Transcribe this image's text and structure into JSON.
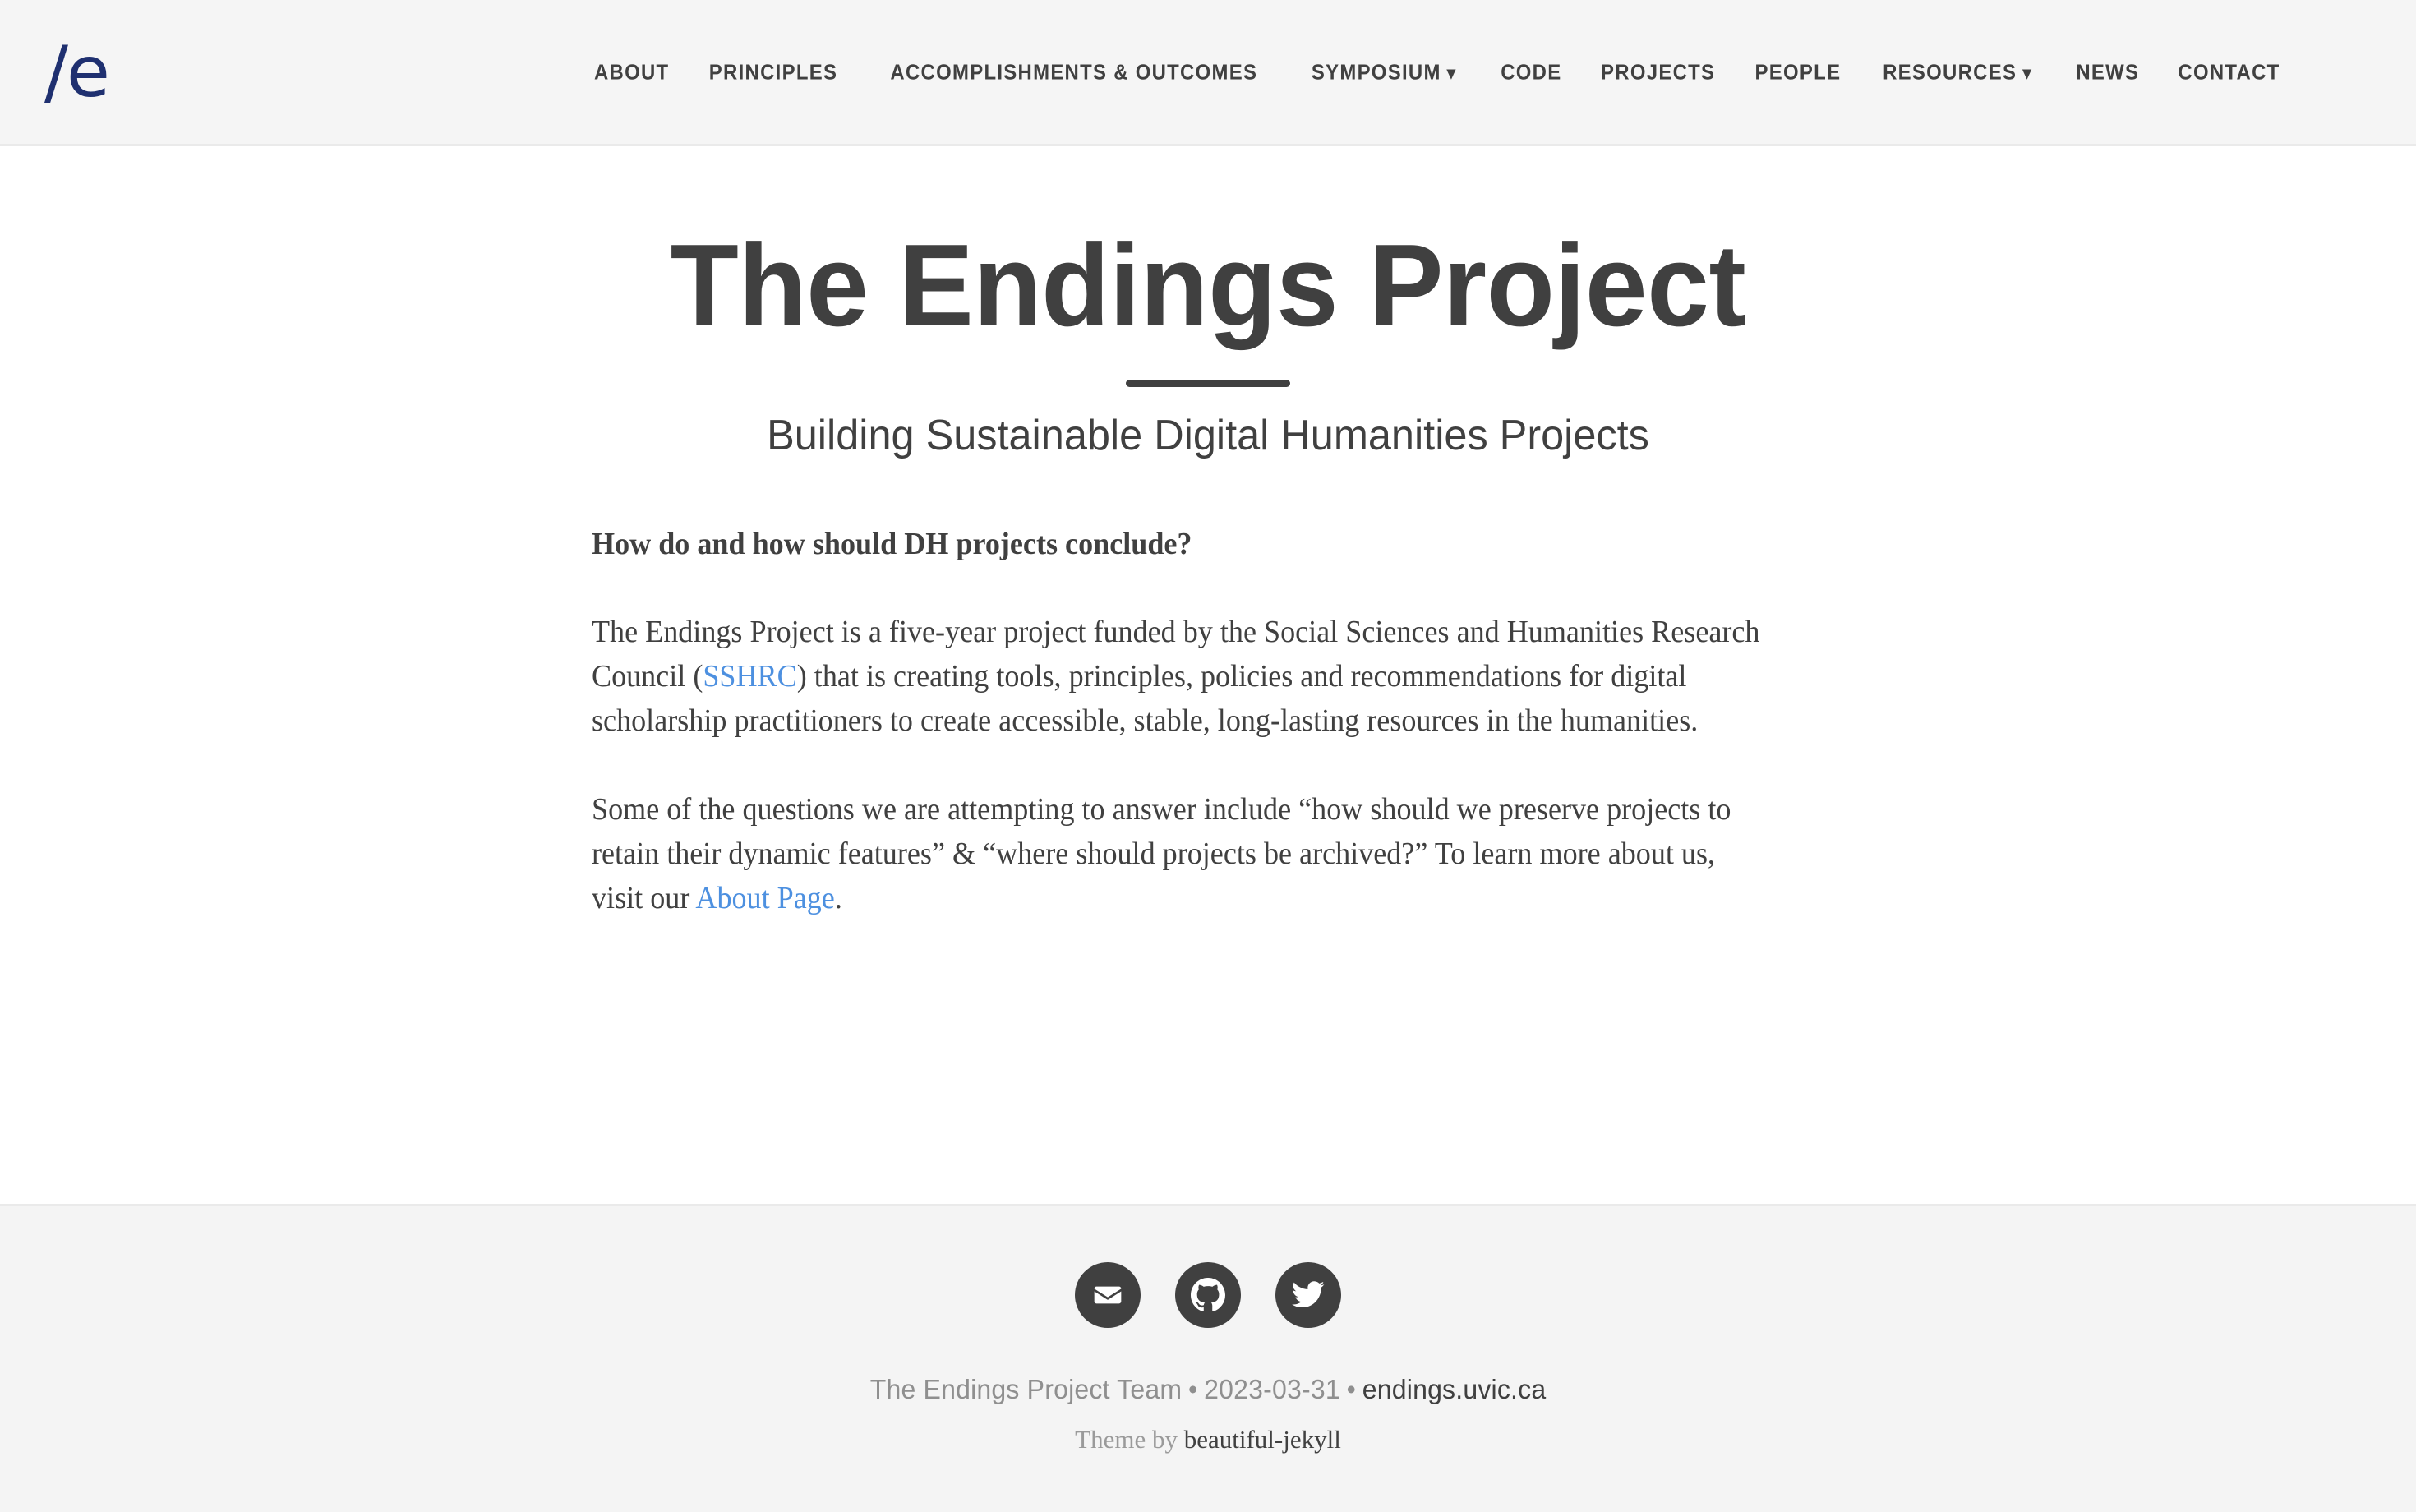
{
  "header": {
    "logo_text": "/e",
    "logo_color": "#1f3070",
    "nav": [
      {
        "label": "ABOUT",
        "has_dropdown": false
      },
      {
        "label": "PRINCIPLES",
        "has_dropdown": false
      },
      {
        "label": "ACCOMPLISHMENTS & OUTCOMES",
        "has_dropdown": false
      },
      {
        "label": "SYMPOSIUM",
        "has_dropdown": true,
        "caret": "▼"
      },
      {
        "label": "CODE",
        "has_dropdown": false
      },
      {
        "label": "PROJECTS",
        "has_dropdown": false
      },
      {
        "label": "PEOPLE",
        "has_dropdown": false
      },
      {
        "label": "RESOURCES",
        "has_dropdown": true,
        "caret": "▼"
      },
      {
        "label": "NEWS",
        "has_dropdown": false
      },
      {
        "label": "CONTACT",
        "has_dropdown": false
      }
    ]
  },
  "hero": {
    "title": "The Endings Project",
    "subtitle": "Building Sustainable Digital Humanities Projects"
  },
  "content": {
    "heading": "How do and how should DH projects conclude?",
    "paragraph1_part1": "The Endings Project is a five-year project funded by the Social Sciences and Humanities Research Council (",
    "paragraph1_link": "SSHRC",
    "paragraph1_part2": ") that is creating tools, principles, policies and recommendations for digital scholarship practitioners to create accessible, stable, long-lasting resources in the humanities.",
    "paragraph2_part1": "Some of the questions we are attempting to answer include “how should we preserve projects to retain their dynamic features” & “where should projects be archived?” To learn more about us, visit our ",
    "paragraph2_link": "About Page",
    "paragraph2_part2": "."
  },
  "footer": {
    "social": [
      {
        "name": "email",
        "title": "Email"
      },
      {
        "name": "github",
        "title": "GitHub"
      },
      {
        "name": "twitter",
        "title": "Twitter"
      }
    ],
    "author": "The Endings Project Team",
    "separator1": "•",
    "date": "2023-03-31",
    "separator2": "•",
    "site_url": "endings.uvic.ca",
    "theme_prefix": "Theme by ",
    "theme_name": "beautiful-jekyll"
  },
  "colors": {
    "text": "#404040",
    "link": "#4d90e0",
    "header_bg": "#f5f5f5",
    "footer_bg": "#f4f4f4",
    "muted": "#8f8f8f"
  }
}
